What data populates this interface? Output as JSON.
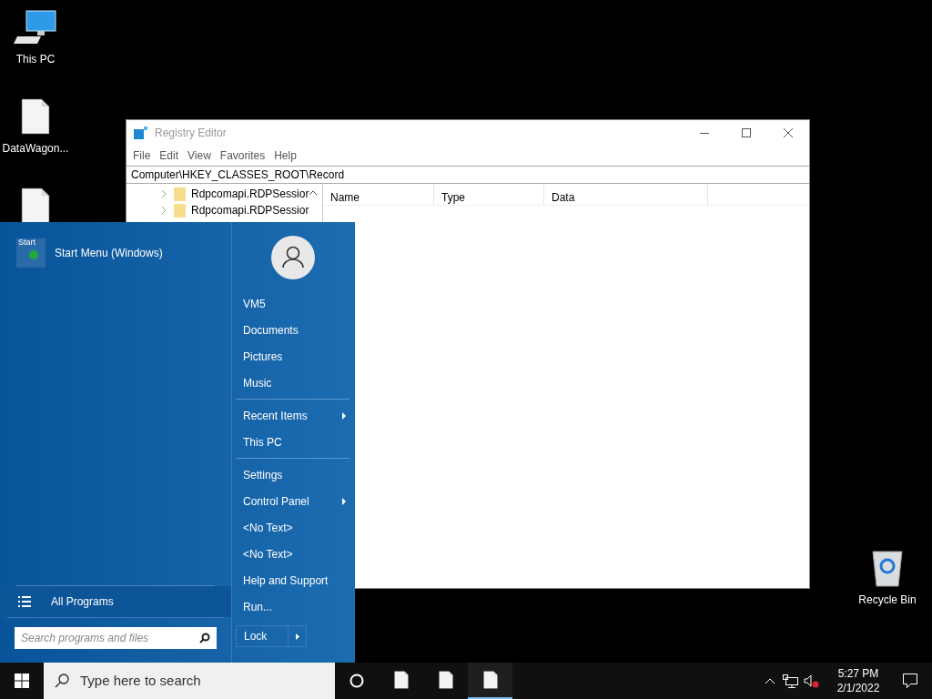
{
  "desktop_icons": [
    {
      "kind": "pc",
      "label": "This PC"
    },
    {
      "kind": "file",
      "label": "DataWagon..."
    },
    {
      "kind": "file"
    }
  ],
  "recycle_bin": {
    "label": "Recycle Bin"
  },
  "window": {
    "title": "Registry Editor",
    "menu": [
      "File",
      "Edit",
      "View",
      "Favorites",
      "Help"
    ],
    "address": "Computer\\HKEY_CLASSES_ROOT\\Record",
    "tree": [
      "Rdpcomapi.RDPSessior",
      "Rdpcomapi.RDPSessior"
    ],
    "columns": [
      "Name",
      "Type",
      "Data"
    ]
  },
  "start_menu": {
    "header": {
      "logo_text": "Start",
      "label": "Start Menu (Windows)"
    },
    "all_programs": "All Programs",
    "search": {
      "placeholder": "Search programs and files"
    },
    "right_items": [
      {
        "label": "VM5",
        "submenu": false,
        "separator_after": false
      },
      {
        "label": "Documents",
        "submenu": false,
        "separator_after": false
      },
      {
        "label": "Pictures",
        "submenu": false,
        "separator_after": false
      },
      {
        "label": "Music",
        "submenu": false,
        "separator_after": true
      },
      {
        "label": "Recent Items",
        "submenu": true,
        "separator_after": false
      },
      {
        "label": "This PC",
        "submenu": false,
        "separator_after": true
      },
      {
        "label": "Settings",
        "submenu": false,
        "separator_after": false
      },
      {
        "label": "Control Panel",
        "submenu": true,
        "separator_after": false
      },
      {
        "label": "<No Text>",
        "submenu": false,
        "separator_after": false
      },
      {
        "label": "<No Text>",
        "submenu": false,
        "separator_after": false
      },
      {
        "label": "Help and Support",
        "submenu": false,
        "separator_after": false
      },
      {
        "label": "Run...",
        "submenu": false,
        "separator_after": false
      }
    ],
    "lock": "Lock"
  },
  "taskbar": {
    "search": {
      "placeholder": "Type here to search"
    },
    "apps": [
      {
        "selected": false
      },
      {
        "selected": false
      },
      {
        "selected": true
      }
    ],
    "time": "5:27 PM",
    "date": "2/1/2022"
  }
}
